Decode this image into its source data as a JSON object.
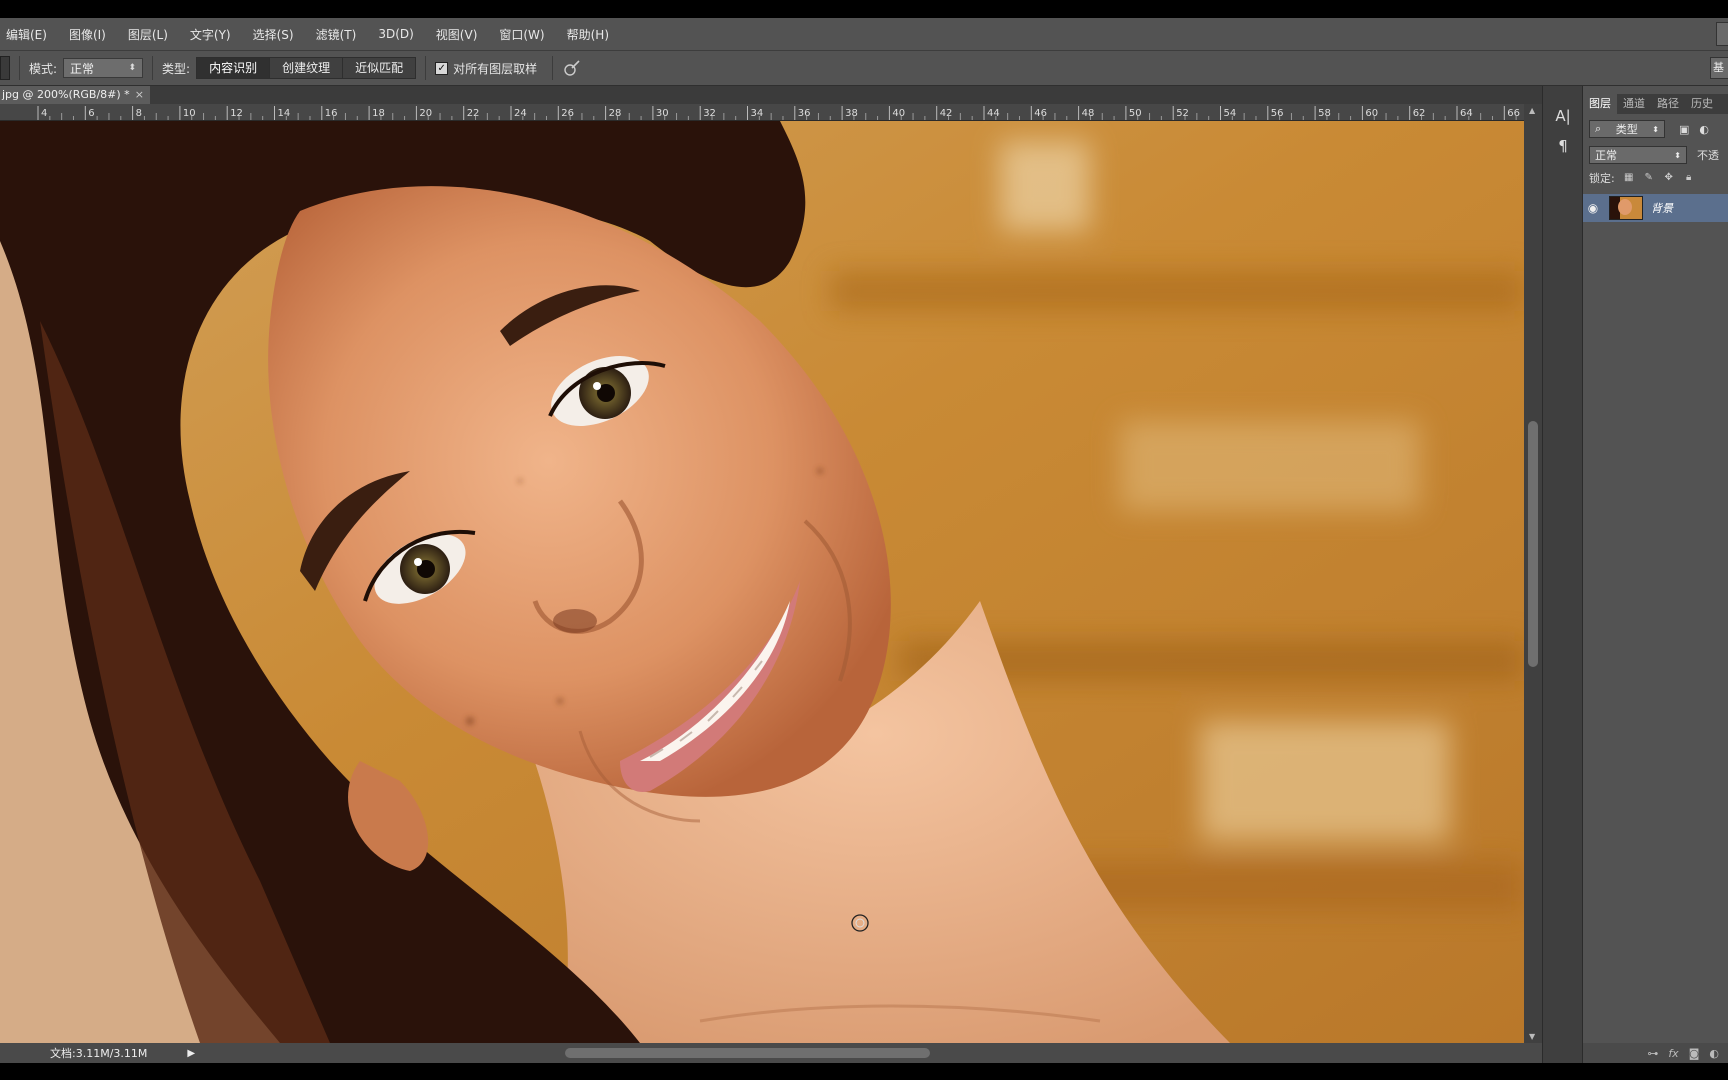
{
  "menu": [
    "编辑(E)",
    "图像(I)",
    "图层(L)",
    "文字(Y)",
    "选择(S)",
    "滤镜(T)",
    "3D(D)",
    "视图(V)",
    "窗口(W)",
    "帮助(H)"
  ],
  "options": {
    "mode_label": "模式:",
    "mode_value": "正常",
    "type_label": "类型:",
    "type_buttons": [
      "内容识别",
      "创建纹理",
      "近似匹配"
    ],
    "active_type": "内容识别",
    "sample_all_layers_label": "对所有图层取样",
    "sample_all_layers_checked": true
  },
  "document": {
    "tab_title": "jpg @ 200%(RGB/8#) *",
    "close_symbol": "×"
  },
  "ruler": {
    "labels": [
      "4",
      "6",
      "8",
      "10",
      "12",
      "14",
      "16",
      "18",
      "20",
      "22",
      "24",
      "26",
      "28",
      "30",
      "32",
      "34",
      "36",
      "38",
      "40",
      "42",
      "44",
      "46",
      "48",
      "50",
      "52",
      "54",
      "56",
      "58",
      "60",
      "62",
      "64",
      "66"
    ]
  },
  "status": {
    "doc_info": "文档:3.11M/3.11M"
  },
  "layers_panel": {
    "tabs": [
      "图层",
      "通道",
      "路径",
      "历史"
    ],
    "filter_label": "类型",
    "blend_mode": "正常",
    "opacity_label": "不透",
    "lock_label": "锁定:",
    "layer_name": "背景",
    "bottom_icons": [
      "link-icon",
      "fx-icon",
      "mask-icon",
      "adjustment-icon"
    ]
  },
  "colors": {
    "ui_dark": "#535353",
    "panel_selected": "#5b6f8d",
    "canvas_bg": "#c9893a"
  }
}
